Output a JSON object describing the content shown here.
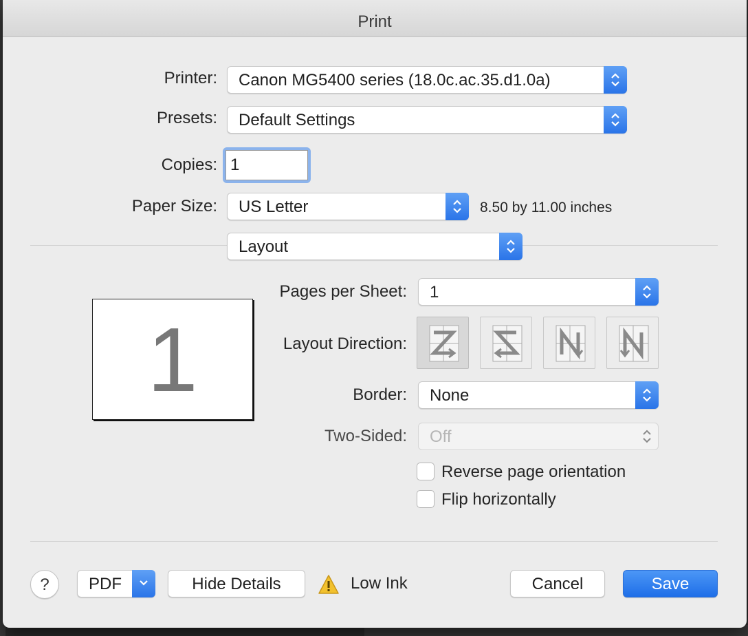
{
  "window": {
    "title": "Print"
  },
  "printer": {
    "label": "Printer:",
    "value": "Canon MG5400 series (18.0c.ac.35.d1.0a)"
  },
  "presets": {
    "label": "Presets:",
    "value": "Default Settings"
  },
  "copies": {
    "label": "Copies:",
    "value": "1"
  },
  "paper": {
    "label": "Paper Size:",
    "value": "US Letter",
    "dimensions": "8.50 by 11.00 inches"
  },
  "section": {
    "value": "Layout"
  },
  "preview": {
    "page_number": "1"
  },
  "layout": {
    "pages_per_sheet": {
      "label": "Pages per Sheet:",
      "value": "1"
    },
    "direction": {
      "label": "Layout Direction:",
      "selected_index": 0
    },
    "border": {
      "label": "Border:",
      "value": "None"
    },
    "two_sided": {
      "label": "Two-Sided:",
      "value": "Off",
      "enabled": false
    },
    "reverse": {
      "label": "Reverse page orientation",
      "checked": false
    },
    "flip": {
      "label": "Flip horizontally",
      "checked": false
    }
  },
  "footer": {
    "help": "?",
    "pdf": "PDF",
    "hide_details": "Hide Details",
    "status": "Low Ink",
    "cancel": "Cancel",
    "save": "Save"
  },
  "icons": {
    "help": "question-mark-icon",
    "warning": "warning-icon",
    "popup": "up-down-chevron-icon"
  },
  "colors": {
    "accent": "#2a74e8",
    "warning": "#f2c12e"
  }
}
